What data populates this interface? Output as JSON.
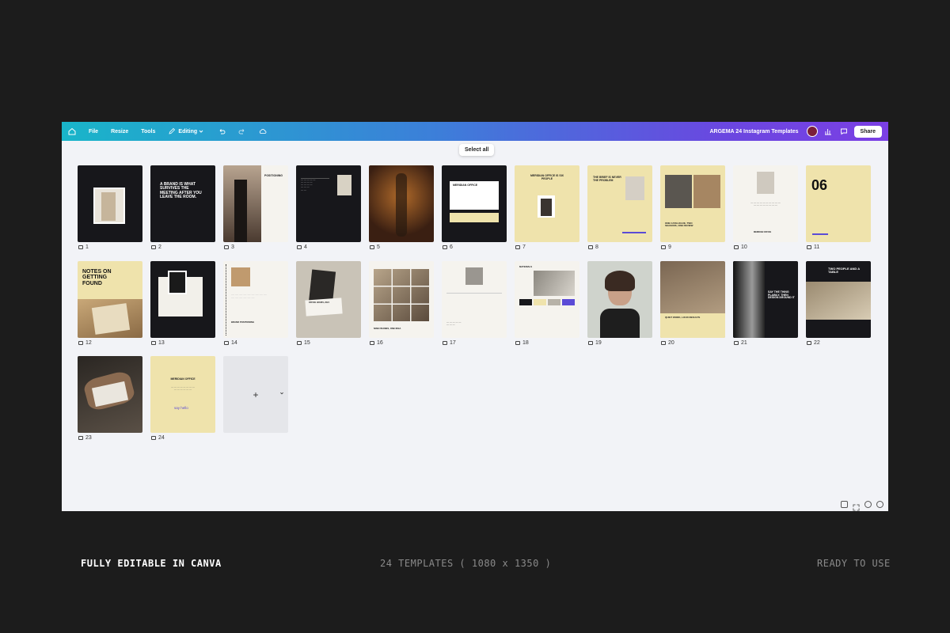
{
  "toolbar": {
    "file": "File",
    "resize": "Resize",
    "tools": "Tools",
    "editing": "Editing",
    "doc_title": "ARGEMA 24 Instagram Templates",
    "share": "Share"
  },
  "select_all": "Select all",
  "pages": [
    {
      "num": "1"
    },
    {
      "num": "2",
      "text": "A BRAND IS WHAT SURVIVES THE MEETING AFTER YOU LEAVE THE ROOM."
    },
    {
      "num": "3",
      "text": "POSITIONING"
    },
    {
      "num": "4"
    },
    {
      "num": "5"
    },
    {
      "num": "6",
      "text": "MERIDIAN OFFICE"
    },
    {
      "num": "7",
      "text": "MERIDIAN OFFICE IS SIX PEOPLE"
    },
    {
      "num": "8",
      "text": "THE BRIEF IS NEVER THE PROBLEM"
    },
    {
      "num": "9",
      "text": "ONE CATALOGUE, TWO SEASONS, ONE REVIEW"
    },
    {
      "num": "10",
      "text": "MERIDIAN OFFICE"
    },
    {
      "num": "11",
      "text": "06"
    },
    {
      "num": "12",
      "text": "NOTES ON GETTING FOUND"
    },
    {
      "num": "13"
    },
    {
      "num": "14",
      "text": "BRAND POSITIONING"
    },
    {
      "num": "15",
      "text": "OFFICE HOURS, 2024"
    },
    {
      "num": "16",
      "text": "NINE FRAMES, ONE IDEA"
    },
    {
      "num": "17"
    },
    {
      "num": "18",
      "text": "MATERIALS"
    },
    {
      "num": "19"
    },
    {
      "num": "20",
      "text": "QUIET WORK, LOUD RESULTS"
    },
    {
      "num": "21",
      "text": "SAY THE THING PLAINLY, THEN DESIGN AROUND IT"
    },
    {
      "num": "22",
      "text": "TWO PEOPLE AND A TABLE"
    },
    {
      "num": "23"
    },
    {
      "num": "24",
      "text": "MERIDIAN OFFICE",
      "sub": "say hello"
    }
  ],
  "add_page": "+",
  "footer": {
    "left": "FULLY EDITABLE IN CANVA",
    "center": "24 TEMPLATES ( 1080 x 1350 )",
    "right": "READY TO USE"
  },
  "colors": {
    "background": "#1c1c1c",
    "canvas": "#f2f3f7",
    "dark_page": "#17171b",
    "cream_page": "#efe3ac",
    "accent": "#5b4bd6"
  }
}
